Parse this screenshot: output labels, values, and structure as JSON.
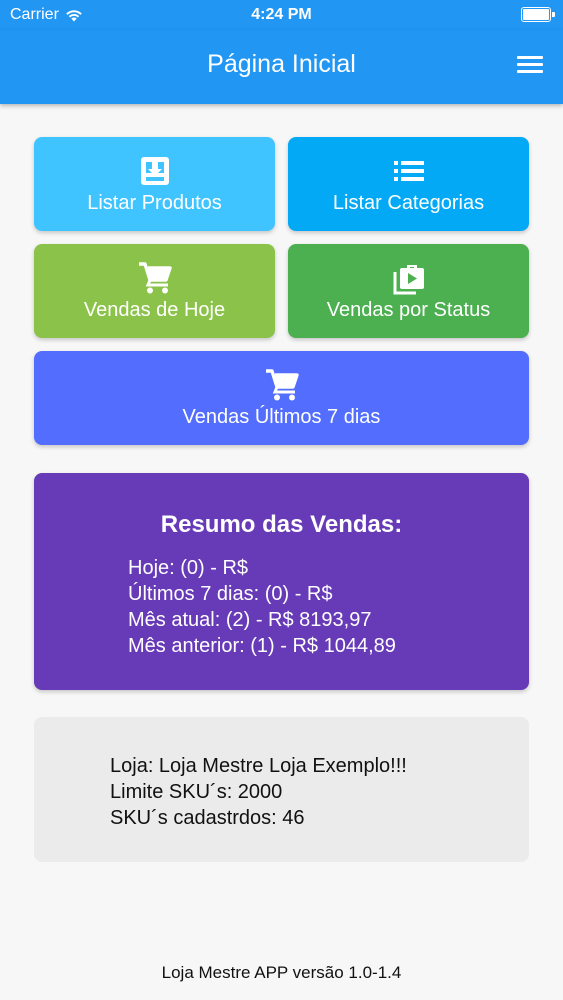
{
  "status_bar": {
    "carrier": "Carrier",
    "time": "4:24 PM"
  },
  "header": {
    "title": "Página Inicial",
    "menu_icon": "menu-icon"
  },
  "tiles": [
    {
      "label": "Listar Produtos",
      "icon": "download-box-icon",
      "color": "#40c4ff"
    },
    {
      "label": "Listar Categorias",
      "icon": "list-icon",
      "color": "#03a9f4"
    },
    {
      "label": "Vendas de Hoje",
      "icon": "cart-icon",
      "color": "#8bc34a"
    },
    {
      "label": "Vendas por Status",
      "icon": "play-library-icon",
      "color": "#4caf50"
    },
    {
      "label": "Vendas Últimos 7 dias",
      "icon": "cart-icon",
      "color": "#536dfe"
    }
  ],
  "summary": {
    "title": "Resumo das Vendas:",
    "lines": [
      "Hoje: (0) - R$",
      "Últimos 7 dias: (0) - R$",
      "Mês atual: (2) - R$ 8193,97",
      "Mês anterior: (1) - R$ 1044,89"
    ],
    "color": "#673ab7"
  },
  "store_info": {
    "lines": [
      "Loja: Loja Mestre Loja Exemplo!!!",
      "Limite SKU´s: 2000",
      "SKU´s cadastrdos: 46"
    ]
  },
  "footer": {
    "version": "Loja Mestre APP versão 1.0-1.4"
  }
}
